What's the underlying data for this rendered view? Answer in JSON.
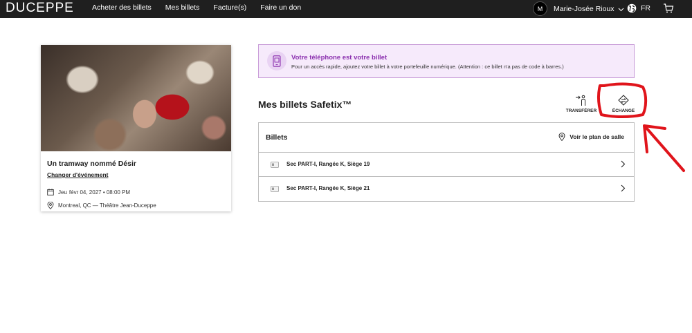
{
  "brand": "DUCEPPE",
  "nav": {
    "items": [
      "Acheter des billets",
      "Mes billets",
      "Facture(s)",
      "Faire un don"
    ]
  },
  "user": {
    "initial": "M",
    "name": "Marie-Josée Rioux"
  },
  "language": "FR",
  "event": {
    "title": "Un tramway nommé Désir",
    "change_link": "Changer d'événement",
    "date_day": "Jeu",
    "date_rest": "févr 04, 2027 • 08:00 PM",
    "location": "Montreal, QC — Théâtre Jean-Duceppe"
  },
  "banner": {
    "title": "Votre téléphone est votre billet",
    "text": "Pour un accès rapide, ajoutez votre billet à votre portefeuille numérique. (Attention : ce billet n'a pas de code à barres.)"
  },
  "safetix": {
    "title": "Mes billets Safetix™",
    "transfer_label": "TRANSFÉRER",
    "exchange_label": "ÉCHANGE"
  },
  "tickets": {
    "header": "Billets",
    "seat_map_label": "Voir le plan de salle",
    "rows": [
      {
        "label": "Sec PART-I, Rangée K, Siège 19"
      },
      {
        "label": "Sec PART-I, Rangée K, Siège 21"
      }
    ]
  },
  "colors": {
    "topbar": "#1f1f1f",
    "banner_bg": "#f6eafb",
    "banner_border": "#c89cd8",
    "banner_title": "#8a2fae",
    "annotation": "#e0141b"
  }
}
